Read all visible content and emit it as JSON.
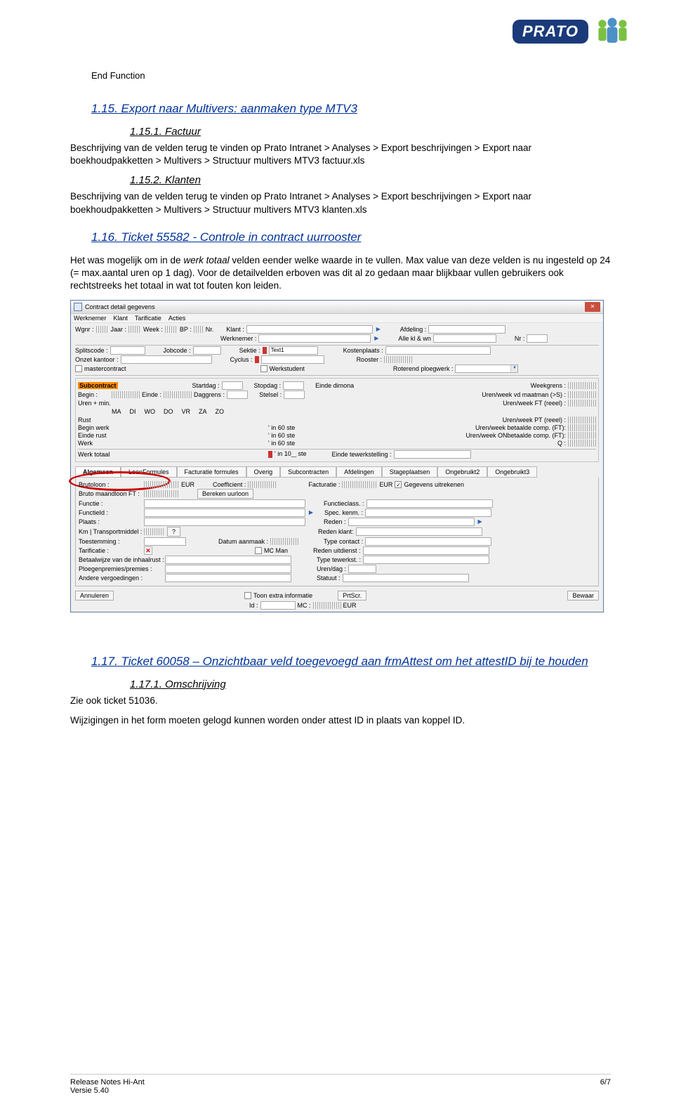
{
  "logo": {
    "text": "PRATO"
  },
  "end_function": "End Function",
  "s115": {
    "heading": "1.15.  Export naar Multivers: aanmaken type MTV3",
    "sub1_heading": "1.15.1. Factuur",
    "sub1_body": "Beschrijving van de velden terug te vinden op Prato Intranet > Analyses > Export beschrijvingen > Export naar boekhoudpakketten > Multivers > Structuur multivers MTV3 factuur.xls",
    "sub2_heading": "1.15.2. Klanten",
    "sub2_body": "Beschrijving van de velden terug te vinden op Prato Intranet > Analyses > Export beschrijvingen > Export naar boekhoudpakketten > Multivers > Structuur multivers MTV3 klanten.xls"
  },
  "s116": {
    "heading": "1.16.  Ticket 55582 - Controle in contract uurrooster",
    "body": "Het was mogelijk om in de werk totaal velden eender welke waarde in te vullen. Max value van deze velden is nu ingesteld op 24 (= max.aantal uren op 1 dag). Voor de detailvelden erboven was dit al zo gedaan maar blijkbaar vullen gebruikers ook rechtstreeks het totaal in wat tot fouten kon leiden."
  },
  "s117": {
    "heading": "1.17.  Ticket 60058 – Onzichtbaar veld toegevoegd aan frmAttest om het attestID bij te houden",
    "sub1_heading": "1.17.1. Omschrijving",
    "body1": "Zie ook ticket 51036.",
    "body2": "Wijzigingen in het form moeten gelogd kunnen worden onder attest ID in plaats van koppel ID."
  },
  "screenshot": {
    "title": "Contract detail gegevens",
    "menu": [
      "Werknemer",
      "Klant",
      "Tarificatie",
      "Acties"
    ],
    "row1": {
      "wgnr": "Wgnr :",
      "jaar": "Jaar :",
      "week": "Week :",
      "bp": "BP :",
      "nr": "Nr.",
      "klant": "Klant :",
      "afdeling": "Afdeling :"
    },
    "row2": {
      "werknemer": "Werknemer :",
      "alle": "Alle kl & wn",
      "nr": "Nr :"
    },
    "row3": {
      "splitscode": "Splitscode :",
      "jobcode": "Jobcode :",
      "sektie": "Sektie :",
      "text1": "Text1",
      "kostenplaats": "Kostenplaats :"
    },
    "row4": {
      "onzet": "Onzet kantoor :",
      "cyclus": "Cyclus :",
      "rooster": "Rooster :"
    },
    "row5": {
      "master": "mastercontract",
      "werkstudent": "Werkstudent",
      "roterend": "Roterend ploegwerk :"
    },
    "subcontract": {
      "label": "Subcontract",
      "startdag": "Startdag :",
      "stopdag": "Stopdag :",
      "einde_dimona": "Einde dimona",
      "weekgrens": "Weekgrens :",
      "begin": "Begin :",
      "einde": "Einde :",
      "daggrens": "Daggrens :",
      "stelsel": "Stelsel :",
      "uwvdm": "Uren/week vd maatman (>S) :",
      "urenmin": "Uren + min.",
      "uwftr": "Uren/week FT (reeel) :",
      "rust": "Rust",
      "uwptr": "Uren/week PT (reeel) :",
      "beginwerk": "Begin werk",
      "in60a": "' in 60 ste",
      "uwbc": "Uren/week betaalde comp. (FT):",
      "einderust": "Einde rust",
      "in60b": "' in 60 ste",
      "unbc": "Uren/week ONbetaalde comp. (FT):",
      "werk": "Werk",
      "in60c": "' in 60 ste",
      "q": "Q :",
      "werktotaal": "Werk totaal",
      "in10": "' in 10‿ ste",
      "eindetw": "Einde tewerkstelling :"
    },
    "days": [
      "MA",
      "DI",
      "WO",
      "DO",
      "VR",
      "ZA",
      "ZO"
    ],
    "tabs": [
      "Algemeen",
      "LoonFormules",
      "Facturatie formules",
      "Overig",
      "Subcontracten",
      "Afdelingen",
      "Stageplaatsen",
      "Ongebruikt2",
      "Ongebruikt3"
    ],
    "tab_body": {
      "brutoloon": "Brutoloon :",
      "eur": "EUR",
      "coefficient": "Coefficient :",
      "facturatie": "Facturatie :",
      "gegevens": "Gegevens uitrekenen",
      "bruto_maand": "Bruto maandloon FT :",
      "bereken": "Bereken uurloon",
      "functie": "Functie :",
      "functieclass": "Functieclass. :",
      "functieid": "FunctieId :",
      "speckenm": "Spec. kenm. :",
      "plaats": "Plaats :",
      "reden": "Reden :",
      "km": "Km | Transportmiddel :",
      "redenklant": "Reden klant:",
      "toestemming": "Toestemming :",
      "datum": "Datum aanmaak :",
      "typecontact": "Type contact :",
      "tarificatie": "Tarificatie :",
      "mcman": "MC Man",
      "redenuitdienst": "Reden uitdienst :",
      "betaalwijze": "Betaalwijze van de inhaalrust :",
      "typetewerkst": "Type tewerkst. :",
      "ploegen": "Ploegenpremies/premies :",
      "urendag": "Uren/dag :",
      "andere": "Andere vergoedingen :",
      "statuut": "Statuut :"
    },
    "bottom": {
      "annuleren": "Annuleren",
      "toon": "Toon extra informatie",
      "id": "Id :",
      "mc": "MC :",
      "prtscr": "PrtScr.",
      "bewaar": "Bewaar"
    }
  },
  "footer": {
    "left1": "Release Notes Hi-Ant",
    "left2": "Versie 5.40",
    "right": "6/7"
  }
}
